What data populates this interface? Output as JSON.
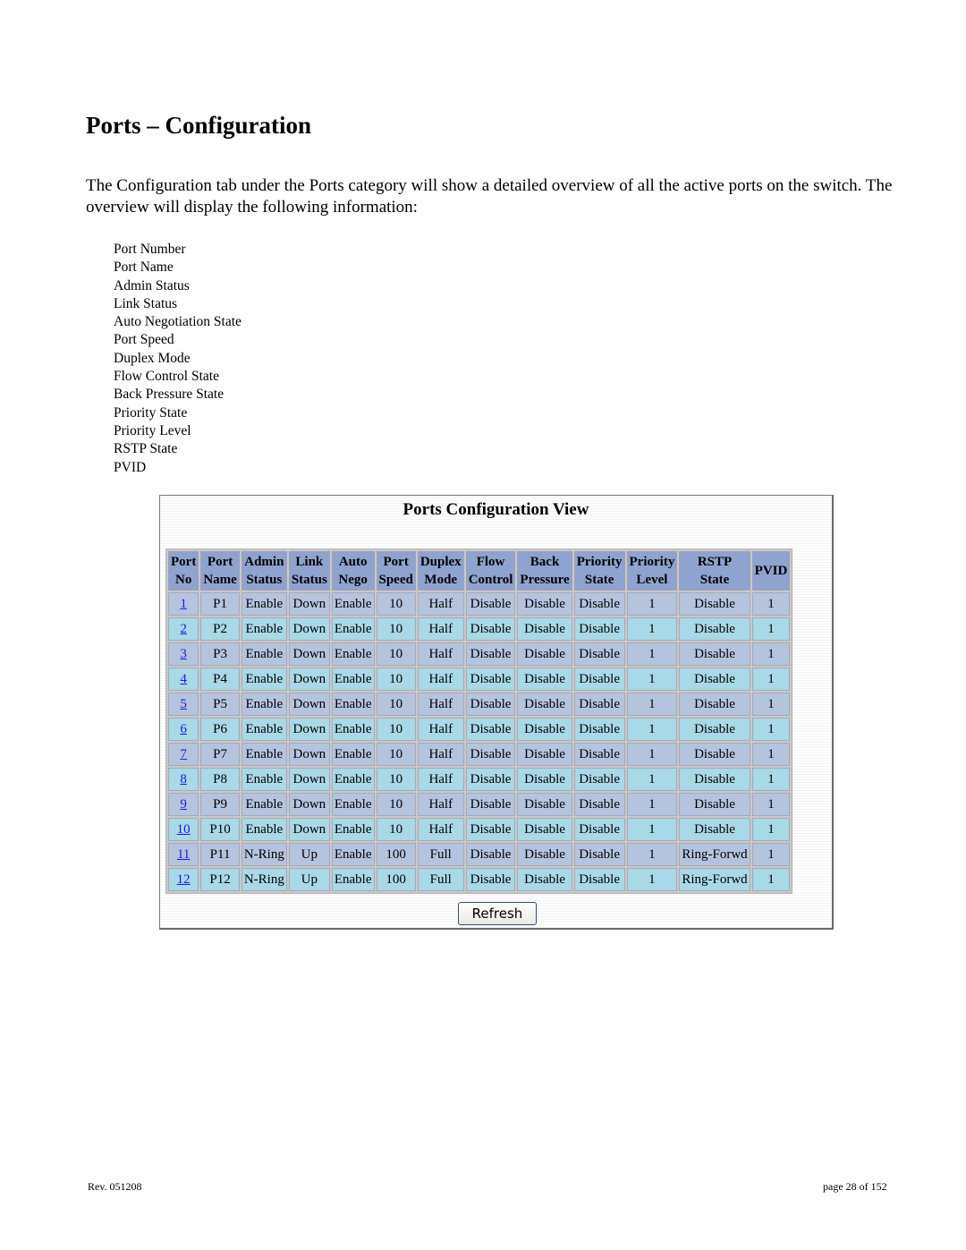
{
  "heading": "Ports – Configuration",
  "intro": "The Configuration tab under the Ports category will show a detailed overview of all the active ports on the switch.  The overview will display the following information:",
  "fields": [
    "Port Number",
    "Port Name",
    "Admin Status",
    "Link Status",
    "Auto Negotiation State",
    "Port Speed",
    "Duplex Mode",
    "Flow Control State",
    "Back Pressure State",
    "Priority State",
    "Priority Level",
    "RSTP State",
    "PVID"
  ],
  "panel": {
    "title": "Ports Configuration View",
    "refresh_label": "Refresh",
    "columns": [
      [
        "Port",
        "No"
      ],
      [
        "Port",
        "Name"
      ],
      [
        "Admin",
        "Status"
      ],
      [
        "Link",
        "Status"
      ],
      [
        "Auto",
        "Nego"
      ],
      [
        "Port",
        "Speed"
      ],
      [
        "Duplex",
        "Mode"
      ],
      [
        "Flow",
        "Control"
      ],
      [
        "Back",
        "Pressure"
      ],
      [
        "Priority",
        "State"
      ],
      [
        "Priority",
        "Level"
      ],
      [
        "RSTP",
        "State"
      ],
      [
        "PVID",
        ""
      ]
    ],
    "rows": [
      [
        "1",
        "P1",
        "Enable",
        "Down",
        "Enable",
        "10",
        "Half",
        "Disable",
        "Disable",
        "Disable",
        "1",
        "Disable",
        "1"
      ],
      [
        "2",
        "P2",
        "Enable",
        "Down",
        "Enable",
        "10",
        "Half",
        "Disable",
        "Disable",
        "Disable",
        "1",
        "Disable",
        "1"
      ],
      [
        "3",
        "P3",
        "Enable",
        "Down",
        "Enable",
        "10",
        "Half",
        "Disable",
        "Disable",
        "Disable",
        "1",
        "Disable",
        "1"
      ],
      [
        "4",
        "P4",
        "Enable",
        "Down",
        "Enable",
        "10",
        "Half",
        "Disable",
        "Disable",
        "Disable",
        "1",
        "Disable",
        "1"
      ],
      [
        "5",
        "P5",
        "Enable",
        "Down",
        "Enable",
        "10",
        "Half",
        "Disable",
        "Disable",
        "Disable",
        "1",
        "Disable",
        "1"
      ],
      [
        "6",
        "P6",
        "Enable",
        "Down",
        "Enable",
        "10",
        "Half",
        "Disable",
        "Disable",
        "Disable",
        "1",
        "Disable",
        "1"
      ],
      [
        "7",
        "P7",
        "Enable",
        "Down",
        "Enable",
        "10",
        "Half",
        "Disable",
        "Disable",
        "Disable",
        "1",
        "Disable",
        "1"
      ],
      [
        "8",
        "P8",
        "Enable",
        "Down",
        "Enable",
        "10",
        "Half",
        "Disable",
        "Disable",
        "Disable",
        "1",
        "Disable",
        "1"
      ],
      [
        "9",
        "P9",
        "Enable",
        "Down",
        "Enable",
        "10",
        "Half",
        "Disable",
        "Disable",
        "Disable",
        "1",
        "Disable",
        "1"
      ],
      [
        "10",
        "P10",
        "Enable",
        "Down",
        "Enable",
        "10",
        "Half",
        "Disable",
        "Disable",
        "Disable",
        "1",
        "Disable",
        "1"
      ],
      [
        "11",
        "P11",
        "N-Ring",
        "Up",
        "Enable",
        "100",
        "Full",
        "Disable",
        "Disable",
        "Disable",
        "1",
        "Ring-Forwd",
        "1"
      ],
      [
        "12",
        "P12",
        "N-Ring",
        "Up",
        "Enable",
        "100",
        "Full",
        "Disable",
        "Disable",
        "Disable",
        "1",
        "Ring-Forwd",
        "1"
      ]
    ]
  },
  "footer": {
    "revision": "Rev.  051208",
    "page": "page 28 of 152"
  }
}
